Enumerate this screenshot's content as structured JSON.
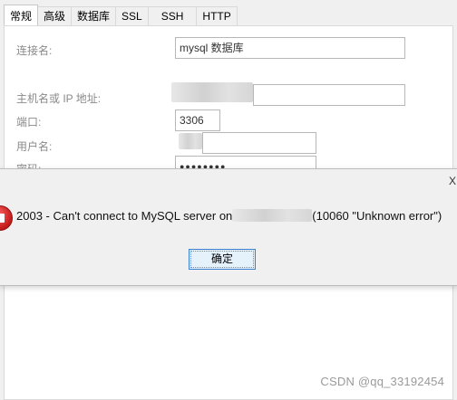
{
  "tabs": [
    "常规",
    "高级",
    "数据库",
    "SSL",
    "SSH",
    "HTTP"
  ],
  "form": {
    "connection_name_label": "连接名:",
    "connection_name_value": "mysql 数据库",
    "host_label": "主机名或 IP 地址:",
    "port_label": "端口:",
    "port_value": "3306",
    "user_label": "用户名:",
    "password_label": "密码:",
    "password_value": "●●●●●●●●"
  },
  "dialog": {
    "close_label": "X",
    "message_part1": "2003 - Can't connect to MySQL server on",
    "message_part2": "(10060 \"Unknown error\")",
    "ok_label": "确定"
  },
  "watermark": "CSDN @qq_33192454"
}
